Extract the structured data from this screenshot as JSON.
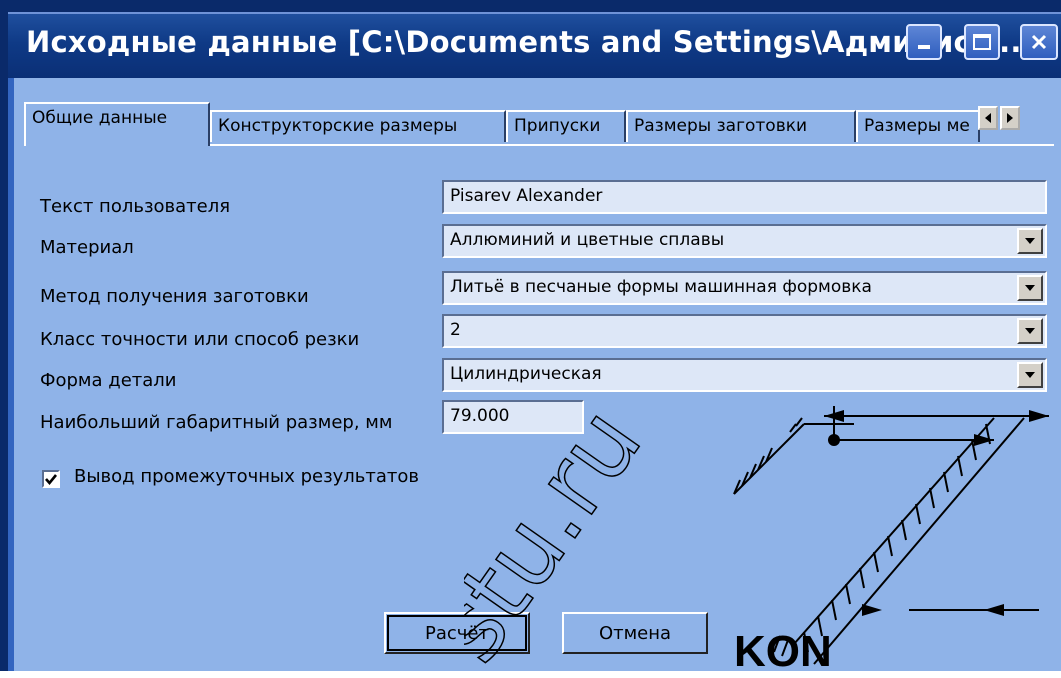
{
  "window": {
    "title": "Исходные данные [C:\\Documents and Settings\\Админист...",
    "minimize_icon": "minimize-icon",
    "maximize_icon": "maximize-icon",
    "close_icon": "close-icon"
  },
  "tabs": [
    {
      "label": "Общие данные",
      "active": true
    },
    {
      "label": "Конструкторские размеры"
    },
    {
      "label": "Припуски"
    },
    {
      "label": "Размеры заготовки"
    },
    {
      "label": "Размеры ме"
    }
  ],
  "form": {
    "user_text": {
      "label": "Текст пользователя",
      "value": "Pisarev Alexander"
    },
    "material": {
      "label": "Материал",
      "value": "Аллюминий и цветные сплавы"
    },
    "blank_method": {
      "label": "Метод получения заготовки",
      "value": "Литьё в песчаные формы машинная формовка"
    },
    "accuracy_class": {
      "label": "Класс точности или способ резки",
      "value": "2"
    },
    "part_shape": {
      "label": "Форма детали",
      "value": "Цилиндрическая"
    },
    "max_size": {
      "label": "Наибольший габаритный размер, мм",
      "value": "79.000"
    },
    "show_intermediate": {
      "label": "Вывод промежуточных результатов",
      "checked": true
    }
  },
  "buttons": {
    "calculate": "Расчёт",
    "cancel": "Отмена"
  },
  "diagram": {
    "label": "KON"
  },
  "watermark": "stu.ru",
  "colors": {
    "title_bar": "#0f3a86",
    "client": "#8fb3e8",
    "field": "#dde7f7"
  }
}
